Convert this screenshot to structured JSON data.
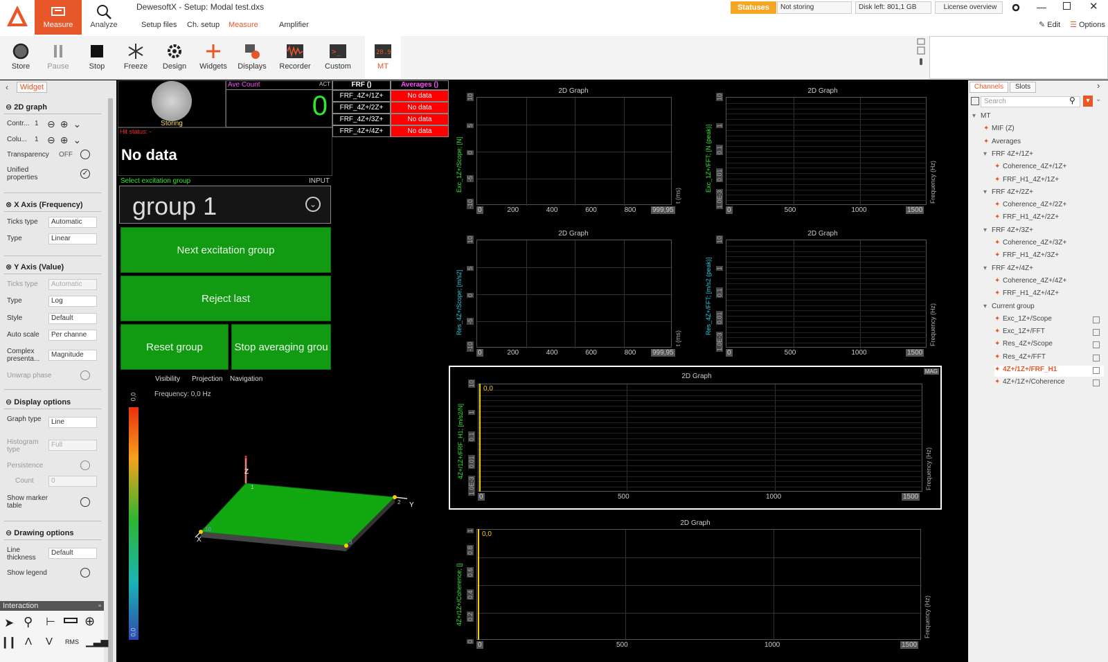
{
  "app": {
    "title": "DewesoftX - Setup: Modal test.dxs"
  },
  "modes": [
    {
      "label": "Measure"
    },
    {
      "label": "Analyze"
    }
  ],
  "subtabs": [
    "Setup files",
    "Ch. setup",
    "Measure",
    "Amplifier"
  ],
  "toolbar": [
    "Store",
    "Pause",
    "Stop",
    "Freeze",
    "Design",
    "Widgets",
    "Displays",
    "Recorder",
    "Custom",
    "MT"
  ],
  "status": {
    "statuses": "Statuses",
    "storing": "Not storing",
    "disk": "Disk left: 801,1 GB",
    "license": "License overview",
    "edit": "Edit",
    "options": "Options"
  },
  "left": {
    "tab": "Widget",
    "graph2d": "2D graph",
    "contr_label": "Contr...",
    "contr_val": "1",
    "colu_label": "Colu...",
    "colu_val": "1",
    "transparency_label": "Transparency",
    "transparency_val": "OFF",
    "unified": "Unified properties",
    "xaxis": "X Axis (Frequency)",
    "ticks_type": "Ticks type",
    "ticks_val": "Automatic",
    "type": "Type",
    "x_type_val": "Linear",
    "yaxis": "Y Axis (Value)",
    "y_ticks_val": "Automatic",
    "y_type_val": "Log",
    "style": "Style",
    "style_val": "Default",
    "autoscale": "Auto scale",
    "autoscale_val": "Per channe",
    "complex": "Complex presenta...",
    "complex_val": "Magnitude",
    "unwrap": "Unwrap phase",
    "display_options": "Display options",
    "graph_type": "Graph type",
    "graph_type_val": "Line",
    "histogram": "Histogram type",
    "histogram_val": "Full",
    "persistence": "Persistence",
    "count": "Count",
    "count_val": "0",
    "show_marker": "Show marker table",
    "drawing": "Drawing options",
    "line_thickness": "Line thickness",
    "line_val": "Default",
    "show_legend": "Show legend",
    "interaction": "Interaction",
    "rms": "RMS"
  },
  "center": {
    "storing": "Storing",
    "ave_count": "Ave Count",
    "act": "ACT",
    "count_value": "0",
    "hit_status": "Hit status: -",
    "no_data": "No data",
    "select_group": "Select excitation group",
    "input": "INPUT",
    "group": "group 1",
    "next": "Next excitation group",
    "reject": "Reject last",
    "reset": "Reset group",
    "stop_avg": "Stop averaging grou",
    "table_head": [
      "FRF ()",
      "Averages ()"
    ],
    "table_rows": [
      {
        "name": "FRF_4Z+/1Z+",
        "val": "No data"
      },
      {
        "name": "FRF_4Z+/2Z+",
        "val": "No data"
      },
      {
        "name": "FRF_4Z+/3Z+",
        "val": "No data"
      },
      {
        "name": "FRF_4Z+/4Z+",
        "val": "No data"
      }
    ],
    "tabs3d": [
      "Visibility",
      "Projection",
      "Navigation"
    ],
    "frequency": "Frequency: 0,0 Hz",
    "scale_top": "0,0",
    "scale_bot": "0,0",
    "axes": {
      "x": "X",
      "y": "Y",
      "z": "Z"
    },
    "points": [
      "1",
      "2",
      "3",
      "10"
    ]
  },
  "graphs": {
    "title": "2D Graph",
    "g1_ylabel": "Exc_1Z+/Scope; [N]",
    "g2_ylabel": "Exc_1Z+/FFT; [N (peak)]",
    "g3_ylabel": "Res_4Z+/Scope; [m/s2]",
    "g4_ylabel": "Res_4Z+/FFT; [m/s2 (peak)]",
    "g5_ylabel": "4Z+/1Z+/FRF_H1; [m/s2/N]",
    "g6_ylabel": "4Z+/1Z+/Coherence; []",
    "t_ms": "t (ms)",
    "freq_hz": "Frequency (Hz)",
    "mag": "MAG",
    "cursor": "0,0",
    "time_ticks": [
      "0",
      "200",
      "400",
      "600",
      "800",
      "999,95"
    ],
    "freq_ticks": [
      "0",
      "500",
      "1000",
      "1500"
    ],
    "lin_y": [
      "10",
      "5",
      "0",
      "-5",
      "-10"
    ],
    "log_y": [
      "10",
      "1",
      "0.1",
      "0.01",
      "1.0E-3"
    ],
    "coh_y": [
      "1",
      "0.8",
      "0.6",
      "0.4",
      "0.2",
      "0"
    ]
  },
  "right": {
    "tabs": [
      "Channels",
      "Slots"
    ],
    "search": "Search",
    "tree": [
      "MT",
      "MIF (Z)",
      "Averages",
      "FRF 4Z+/1Z+",
      "Coherence_4Z+/1Z+",
      "FRF_H1_4Z+/1Z+",
      "FRF 4Z+/2Z+",
      "Coherence_4Z+/2Z+",
      "FRF_H1_4Z+/2Z+",
      "FRF 4Z+/3Z+",
      "Coherence_4Z+/3Z+",
      "FRF_H1_4Z+/3Z+",
      "FRF 4Z+/4Z+",
      "Coherence_4Z+/4Z+",
      "FRF_H1_4Z+/4Z+",
      "Current group",
      "Exc_1Z+/Scope",
      "Exc_1Z+/FFT",
      "Res_4Z+/Scope",
      "Res_4Z+/FFT",
      "4Z+/1Z+/FRF_H1",
      "4Z+/1Z+/Coherence"
    ]
  },
  "colors": {
    "accent": "#e8572a",
    "green": "#139a13",
    "red": "#ff0000"
  }
}
